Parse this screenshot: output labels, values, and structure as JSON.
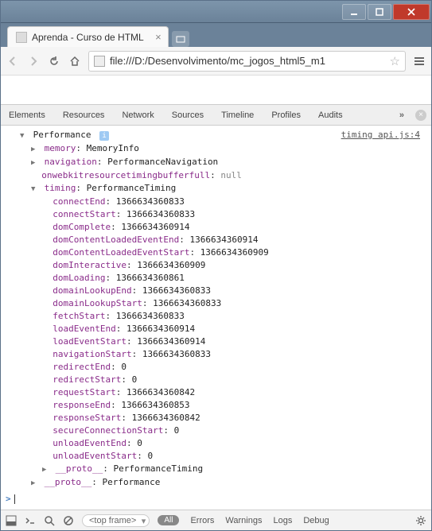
{
  "window": {
    "tab_title": "Aprenda - Curso de HTML",
    "url": "file:///D:/Desenvolvimento/mc_jogos_html5_m1"
  },
  "devtools": {
    "tabs": [
      "Elements",
      "Resources",
      "Network",
      "Sources",
      "Timeline",
      "Profiles",
      "Audits"
    ],
    "source_link": "timing api.js:4",
    "root_label": "Performance",
    "memory": {
      "label": "memory",
      "type": "MemoryInfo"
    },
    "navigation": {
      "label": "navigation",
      "type": "PerformanceNavigation"
    },
    "bufferfull": {
      "label": "onwebkitresourcetimingbufferfull",
      "value": "null"
    },
    "timing": {
      "label": "timing",
      "type": "PerformanceTiming",
      "entries": [
        {
          "k": "connectEnd",
          "v": "1366634360833"
        },
        {
          "k": "connectStart",
          "v": "1366634360833"
        },
        {
          "k": "domComplete",
          "v": "1366634360914"
        },
        {
          "k": "domContentLoadedEventEnd",
          "v": "1366634360914"
        },
        {
          "k": "domContentLoadedEventStart",
          "v": "1366634360909"
        },
        {
          "k": "domInteractive",
          "v": "1366634360909"
        },
        {
          "k": "domLoading",
          "v": "1366634360861"
        },
        {
          "k": "domainLookupEnd",
          "v": "1366634360833"
        },
        {
          "k": "domainLookupStart",
          "v": "1366634360833"
        },
        {
          "k": "fetchStart",
          "v": "1366634360833"
        },
        {
          "k": "loadEventEnd",
          "v": "1366634360914"
        },
        {
          "k": "loadEventStart",
          "v": "1366634360914"
        },
        {
          "k": "navigationStart",
          "v": "1366634360833"
        },
        {
          "k": "redirectEnd",
          "v": "0"
        },
        {
          "k": "redirectStart",
          "v": "0"
        },
        {
          "k": "requestStart",
          "v": "1366634360842"
        },
        {
          "k": "responseEnd",
          "v": "1366634360853"
        },
        {
          "k": "responseStart",
          "v": "1366634360842"
        },
        {
          "k": "secureConnectionStart",
          "v": "0"
        },
        {
          "k": "unloadEventEnd",
          "v": "0"
        },
        {
          "k": "unloadEventStart",
          "v": "0"
        }
      ],
      "proto": {
        "label": "__proto__",
        "type": "PerformanceTiming"
      }
    },
    "proto": {
      "label": "__proto__",
      "type": "Performance"
    }
  },
  "statusbar": {
    "frame": "<top frame>",
    "filters": {
      "all": "All",
      "errors": "Errors",
      "warnings": "Warnings",
      "logs": "Logs",
      "debug": "Debug"
    }
  }
}
